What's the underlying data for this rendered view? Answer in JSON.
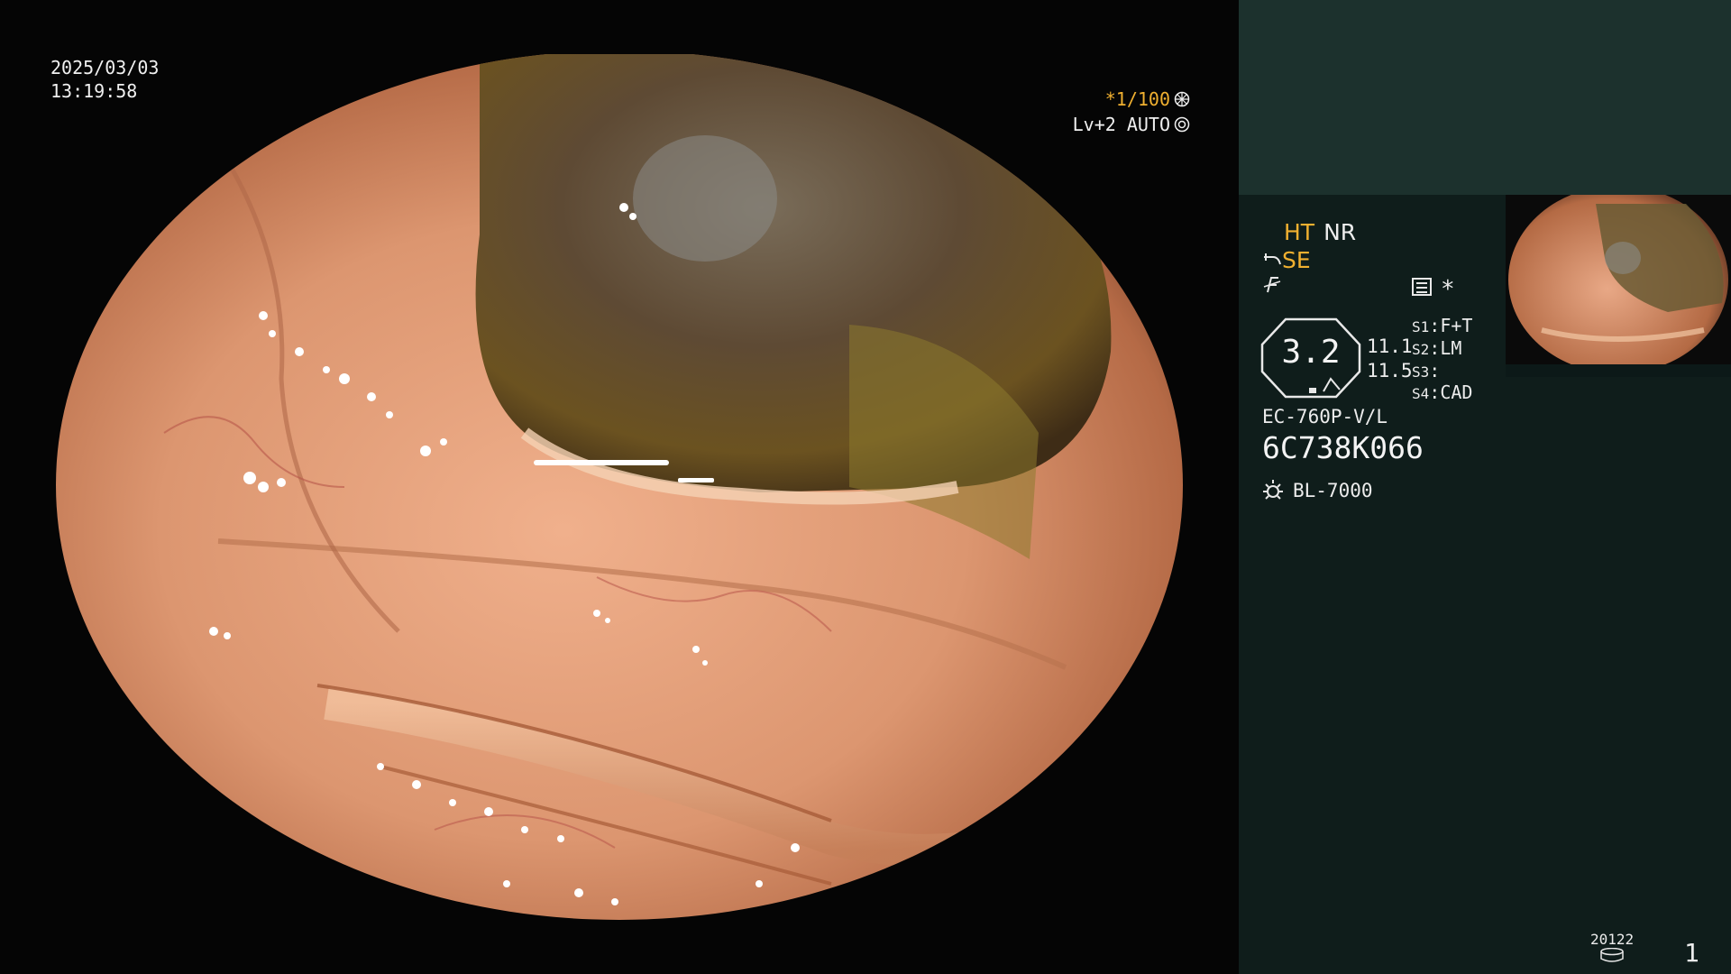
{
  "left": {
    "date": "2025/03/03",
    "time": "13:19:58",
    "shutter": "*1/100",
    "level": "Lv+2 AUTO"
  },
  "panel": {
    "mode_ht": "HT",
    "mode_nr": "NR",
    "mode_se": "SE",
    "zoom": "3.2",
    "val_a": "11.1",
    "val_b": "11.5",
    "asterisk": "*",
    "switches": [
      {
        "id": "S1",
        "value": "F+T"
      },
      {
        "id": "S2",
        "value": "LM"
      },
      {
        "id": "S3",
        "value": ""
      },
      {
        "id": "S4",
        "value": "CAD"
      }
    ],
    "scope_model": "EC-760P-V/L",
    "scope_serial": "6C738K066",
    "light_source": "BL-7000",
    "counter": "20122",
    "page_number": "1"
  },
  "colors": {
    "accent_orange": "#f0b030",
    "panel_bg": "#0f1d1b",
    "panel_band": "#1c312d"
  },
  "icons": [
    "shutter-wheel-icon",
    "auto-ring-icon",
    "scope-bend-icon",
    "f-flag-icon",
    "menu-box-icon",
    "lamp-sun-icon",
    "disk-stack-icon"
  ]
}
